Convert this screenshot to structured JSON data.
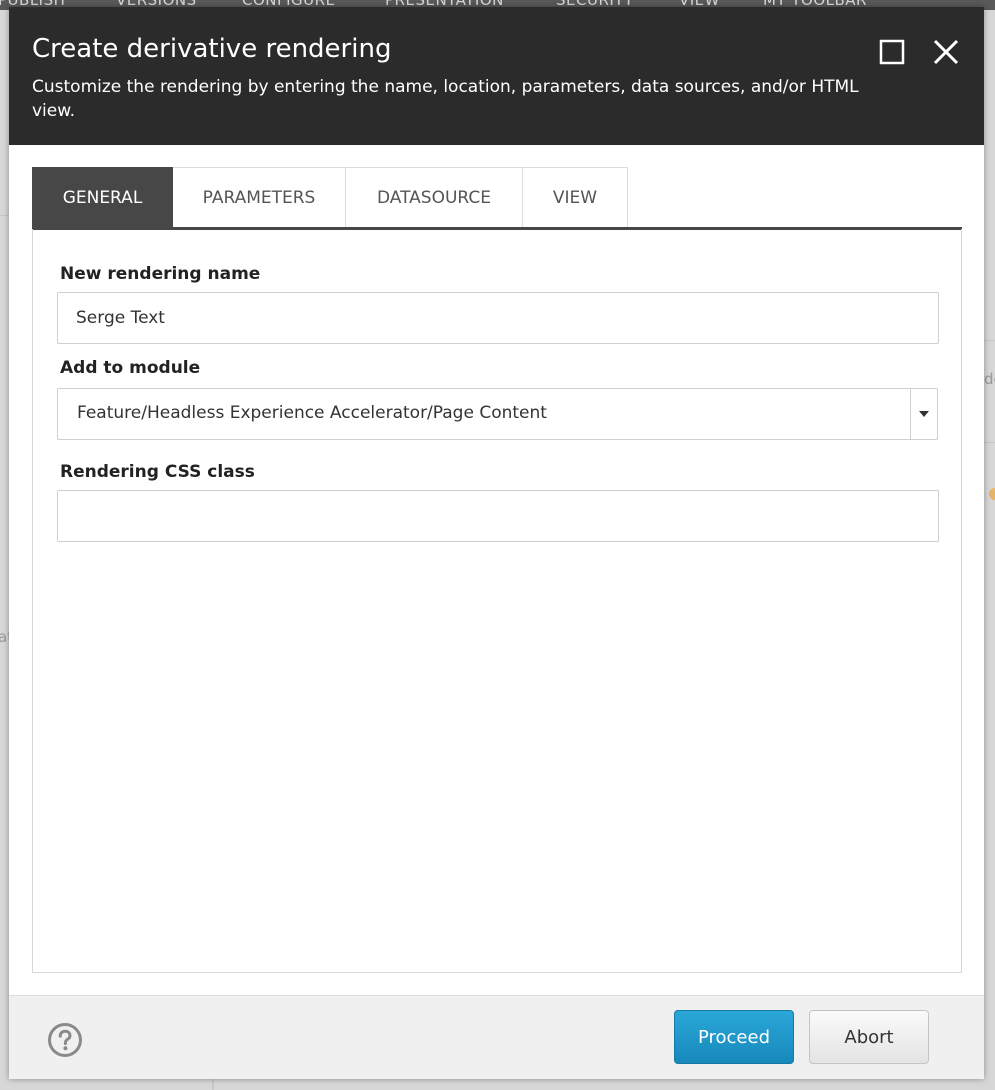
{
  "background": {
    "ribbon_items": [
      "PUBLISH",
      "VERSIONS",
      "CONFIGURE",
      "PRESENTATION",
      "SECURITY",
      "VIEW",
      "MY TOOLBAR"
    ],
    "fragment_left": "at",
    "fragment_right": "de"
  },
  "dialog": {
    "title": "Create derivative rendering",
    "subtitle": "Customize the rendering by entering the name, location, parameters, data sources, and/or HTML view.",
    "maximize_icon": "maximize-icon",
    "close_icon": "close-icon"
  },
  "tabs": [
    {
      "label": "GENERAL",
      "active": true
    },
    {
      "label": "PARAMETERS",
      "active": false
    },
    {
      "label": "DATASOURCE",
      "active": false
    },
    {
      "label": "VIEW",
      "active": false
    }
  ],
  "form": {
    "rendering_name": {
      "label": "New rendering name",
      "value": "Serge Text"
    },
    "module": {
      "label": "Add to module",
      "value": "Feature/Headless Experience Accelerator/Page Content"
    },
    "css_class": {
      "label": "Rendering CSS class",
      "value": ""
    }
  },
  "footer": {
    "help_icon": "help-icon",
    "proceed_label": "Proceed",
    "abort_label": "Abort"
  },
  "colors": {
    "header_bg": "#2b2b2b",
    "active_tab_bg": "#474747",
    "primary_button": "#1f97cb"
  }
}
